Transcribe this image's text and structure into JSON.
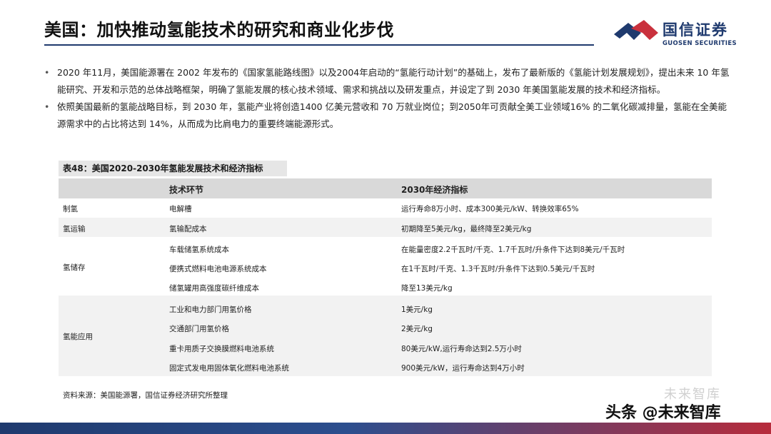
{
  "header": {
    "title": "美国：加快推动氢能技术的研究和商业化步伐",
    "logo_cn": "国信证券",
    "logo_en": "GUOSEN SECURITIES",
    "accent_color": "#1f3a6e",
    "brand_red": "#c9313d"
  },
  "bullets": [
    "2020 年11月，美国能源署在 2002 年发布的《国家氢能路线图》以及2004年启动的“氢能行动计划”的基础上，发布了最新版的《氢能计划发展规划》，提出未来 10 年氢能研究、开发和示范的总体战略框架，明确了氢能发展的核心技术领域、需求和挑战以及研发重点，并设定了到 2030 年美国氢能发展的技术和经济指标。",
    "依照美国最新的氢能战略目标，到 2030 年，氢能产业将创造1400 亿美元营收和 70 万就业岗位；到2050年可贡献全美工业领域16% 的二氧化碳减排量，氢能在全美能源需求中的占比将达到 14%，从而成为比肩电力的重要终端能源形式。"
  ],
  "table": {
    "caption": "表48：美国2020-2030年氢能发展技术和经济指标",
    "headers": [
      "",
      "技术环节",
      "2030年经济指标"
    ],
    "groups": [
      {
        "name": "制氢",
        "rows": [
          [
            "电解槽",
            "运行寿命8万小时、成本300美元/kW、转换效率65%"
          ]
        ]
      },
      {
        "name": "氢运输",
        "rows": [
          [
            "氢输配成本",
            "初期降至5美元/kg，最终降至2美元/kg"
          ]
        ]
      },
      {
        "name": "氢储存",
        "rows": [
          [
            "车载储氢系统成本",
            "在能量密度2.2千瓦时/千克、1.7千瓦时/升条件下达到8美元/千瓦时"
          ],
          [
            "便携式燃料电池电源系统成本",
            "在1千瓦时/千克、1.3千瓦时/升条件下达到0.5美元/千瓦时"
          ],
          [
            "储氢罐用高强度碳纤维成本",
            "降至13美元/kg"
          ]
        ]
      },
      {
        "name": "氢能应用",
        "rows": [
          [
            "工业和电力部门用氢价格",
            "1美元/kg"
          ],
          [
            "交通部门用氢价格",
            "2美元/kg"
          ],
          [
            "重卡用质子交换膜燃料电池系统",
            "80美元/kW,运行寿命达到2.5万小时"
          ],
          [
            "固定式发电用固体氧化燃料电池系统",
            "900美元/kW，运行寿命达到4万小时"
          ]
        ]
      }
    ]
  },
  "source": "资料来源：美国能源署，国信证券经济研究所整理",
  "watermark": "头条 @未来智库",
  "watermark_faint": "未来智库"
}
